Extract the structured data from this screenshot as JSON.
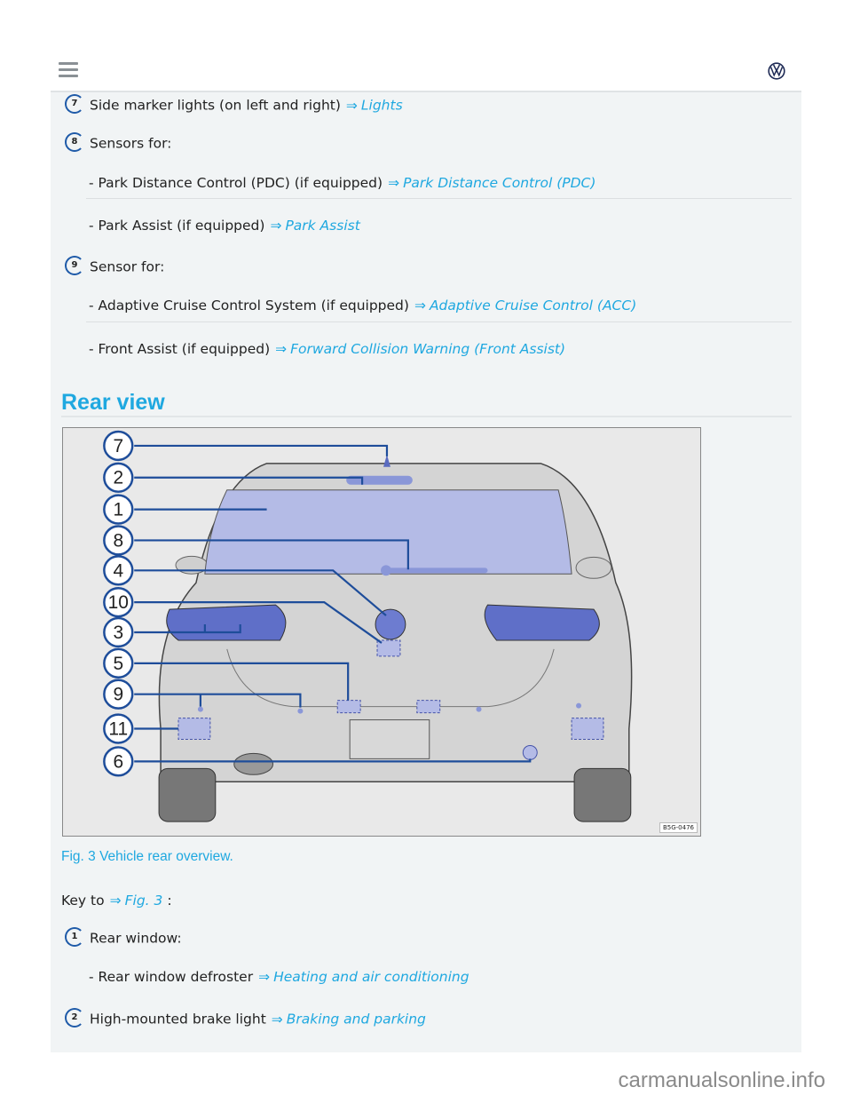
{
  "header": {
    "menu_icon": "hamburger-menu-icon",
    "logo_icon": "vw-logo-icon"
  },
  "items_top": [
    {
      "badge": "7",
      "text": "Side marker lights (on left and right)",
      "link": "Lights"
    },
    {
      "badge": "8",
      "text": "Sensors for:",
      "subitems": [
        {
          "text": "- Park Distance Control (PDC) (if equipped)",
          "link": "Park Distance Control (PDC)"
        },
        {
          "text": "- Park Assist (if equipped)",
          "link": "Park Assist"
        }
      ]
    },
    {
      "badge": "9",
      "text": "Sensor for:",
      "subitems": [
        {
          "text": "- Adaptive Cruise Control System (if equipped)",
          "link": "Adaptive Cruise Control (ACC)"
        },
        {
          "text": "- Front Assist (if equipped)",
          "link": "Forward Collision Warning (Front Assist)"
        }
      ]
    }
  ],
  "arrow": "⇒",
  "section": {
    "title": "Rear view",
    "figure": {
      "callouts": [
        "7",
        "2",
        "1",
        "8",
        "4",
        "10",
        "3",
        "5",
        "9",
        "11",
        "6"
      ],
      "code": "B5G-0476",
      "caption": "Fig. 3 Vehicle rear overview."
    },
    "key_prefix": "Key to",
    "key_link": "Fig. 3",
    "key_suffix": ":"
  },
  "items_bottom": [
    {
      "badge": "1",
      "text": "Rear window:",
      "subitems": [
        {
          "text": "- Rear window defroster",
          "link": "Heating and air conditioning"
        }
      ]
    },
    {
      "badge": "2",
      "text": "High-mounted brake light",
      "link": "Braking and parking"
    }
  ],
  "watermark": "carmanualsonline.info",
  "colors": {
    "accent": "#1fa8e0",
    "badge_ring": "#1e5aa8",
    "panel_bg": "#f1f4f5"
  }
}
